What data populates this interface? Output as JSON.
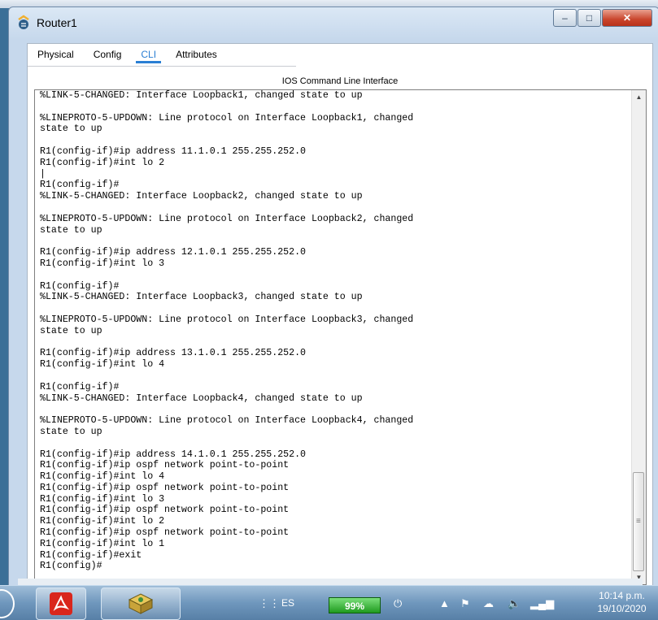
{
  "window": {
    "title": "Router1",
    "controls": {
      "minimize": "–",
      "maximize": "□",
      "close": "✕"
    }
  },
  "tabs": [
    {
      "label": "Physical"
    },
    {
      "label": "Config"
    },
    {
      "label": "CLI"
    },
    {
      "label": "Attributes"
    }
  ],
  "active_tab": "CLI",
  "cli": {
    "heading": "IOS Command Line Interface",
    "output": "%LINK-5-CHANGED: Interface Loopback1, changed state to up\n\n%LINEPROTO-5-UPDOWN: Line protocol on Interface Loopback1, changed\nstate to up\n\nR1(config-if)#ip address 11.1.0.1 255.255.252.0\nR1(config-if)#int lo 2\n|\nR1(config-if)#\n%LINK-5-CHANGED: Interface Loopback2, changed state to up\n\n%LINEPROTO-5-UPDOWN: Line protocol on Interface Loopback2, changed\nstate to up\n\nR1(config-if)#ip address 12.1.0.1 255.255.252.0\nR1(config-if)#int lo 3\n\nR1(config-if)#\n%LINK-5-CHANGED: Interface Loopback3, changed state to up\n\n%LINEPROTO-5-UPDOWN: Line protocol on Interface Loopback3, changed\nstate to up\n\nR1(config-if)#ip address 13.1.0.1 255.255.252.0\nR1(config-if)#int lo 4\n\nR1(config-if)#\n%LINK-5-CHANGED: Interface Loopback4, changed state to up\n\n%LINEPROTO-5-UPDOWN: Line protocol on Interface Loopback4, changed\nstate to up\n\nR1(config-if)#ip address 14.1.0.1 255.255.252.0\nR1(config-if)#ip ospf network point-to-point\nR1(config-if)#int lo 4\nR1(config-if)#ip ospf network point-to-point\nR1(config-if)#int lo 3\nR1(config-if)#ip ospf network point-to-point\nR1(config-if)#int lo 2\nR1(config-if)#ip ospf network point-to-point\nR1(config-if)#int lo 1\nR1(config-if)#exit\nR1(config)#"
  },
  "taskbar": {
    "language": "ES",
    "battery_percent": "99%",
    "time": "10:14 p.m.",
    "date": "19/10/2020"
  },
  "colors": {
    "active_tab": "#2a7fd4",
    "close_button": "#c9452c",
    "battery": "#1f9a1f"
  }
}
